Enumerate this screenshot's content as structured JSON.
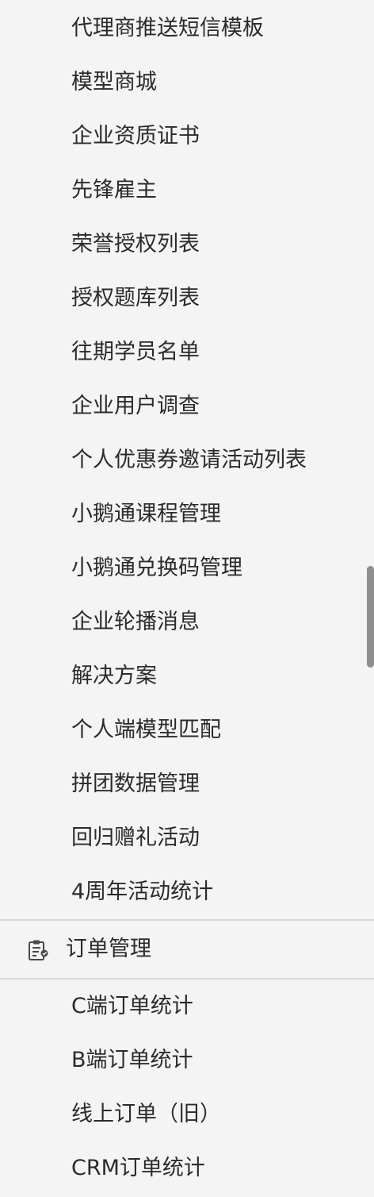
{
  "submenu_top": {
    "items": [
      "代理商推送短信模板",
      "模型商城",
      "企业资质证书",
      "先锋雇主",
      "荣誉授权列表",
      "授权题库列表",
      "往期学员名单",
      "企业用户调查",
      "个人优惠券邀请活动列表",
      "小鹅通课程管理",
      "小鹅通兑换码管理",
      "企业轮播消息",
      "解决方案",
      "个人端模型匹配",
      "拼团数据管理",
      "回归赠礼活动",
      "4周年活动统计"
    ]
  },
  "order_section": {
    "title": "订单管理",
    "icon": "clipboard-icon",
    "items": [
      "C端订单统计",
      "B端订单统计",
      "线上订单（旧）",
      "CRM订单统计"
    ]
  },
  "colors": {
    "background": "#f4f4f4",
    "text": "#2b2b2b",
    "divider": "#d9d9d9",
    "scrollbar": "#8e8e8e"
  }
}
